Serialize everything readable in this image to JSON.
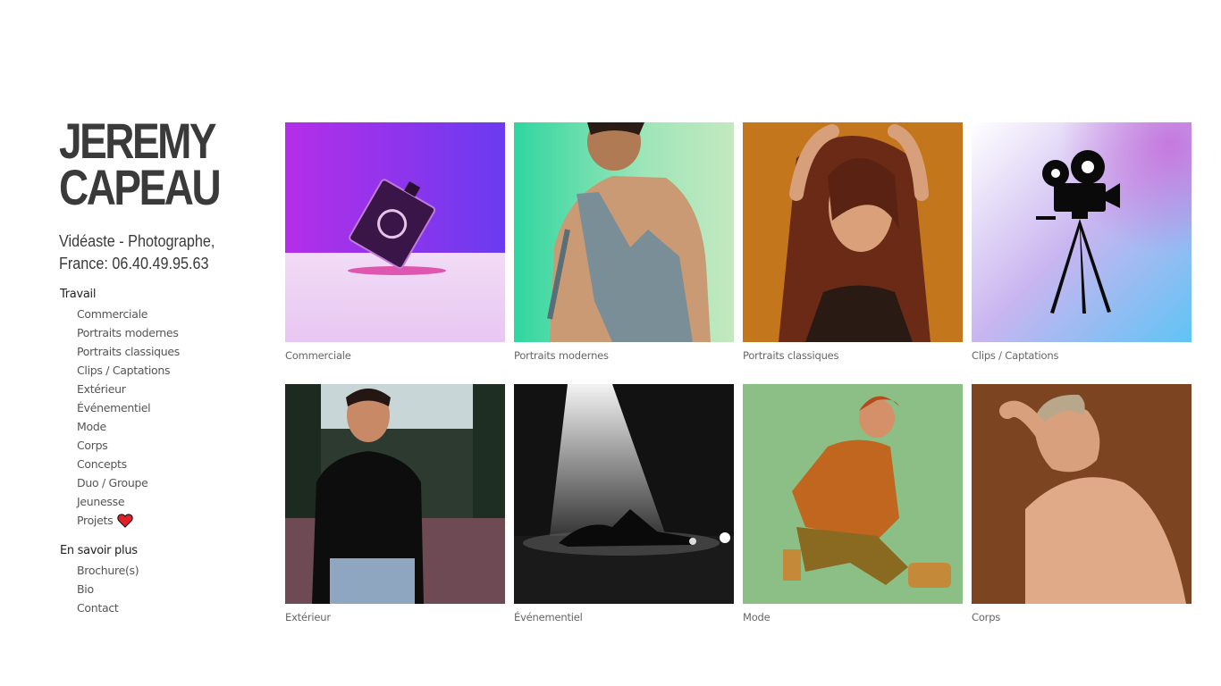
{
  "site": {
    "title_line1": "JEREMY",
    "title_line2": "CAPEAU",
    "tagline_line1": "Vidéaste - Photographe,",
    "tagline_line2": "France: 06.40.49.95.63"
  },
  "nav": {
    "work_heading": "Travail",
    "work_items": [
      "Commerciale",
      "Portraits modernes",
      "Portraits classiques",
      "Clips / Captations",
      "Extérieur",
      "Événementiel",
      "Mode",
      "Corps",
      "Concepts",
      "Duo / Groupe",
      "Jeunesse",
      "Projets"
    ],
    "more_heading": "En savoir plus",
    "more_items": [
      "Brochure(s)",
      "Bio",
      "Contact"
    ]
  },
  "gallery": [
    {
      "caption": "Commerciale",
      "image": "perfume-bottle-photo"
    },
    {
      "caption": "Portraits modernes",
      "image": "man-in-overalls-photo"
    },
    {
      "caption": "Portraits classiques",
      "image": "woman-hands-in-hair-photo"
    },
    {
      "caption": "Clips / Captations",
      "image": "film-camera-icon"
    },
    {
      "caption": "Extérieur",
      "image": "young-man-outdoor-photo"
    },
    {
      "caption": "Événementiel",
      "image": "dancer-on-stage-photo"
    },
    {
      "caption": "Mode",
      "image": "man-kneeling-orange-jacket-photo"
    },
    {
      "caption": "Corps",
      "image": "shirtless-person-photo"
    }
  ],
  "colors": {
    "title": "#3a3a3a",
    "nav_text": "#555555",
    "heart": "#e0202a"
  }
}
